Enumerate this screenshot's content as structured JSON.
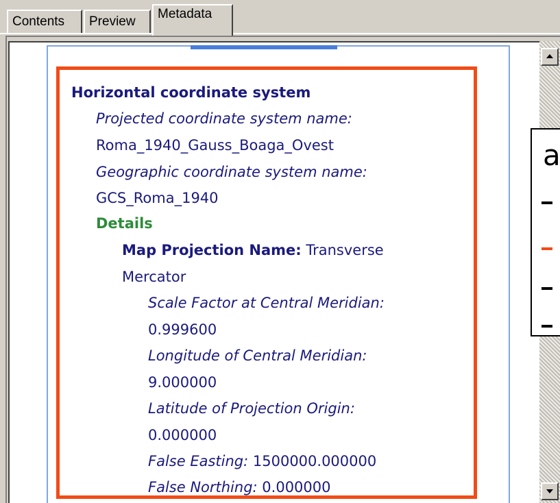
{
  "tabs": [
    {
      "label": "Contents",
      "active": false
    },
    {
      "label": "Preview",
      "active": false
    },
    {
      "label": "Metadata",
      "active": true
    }
  ],
  "metadata": {
    "heading": "Horizontal coordinate system",
    "projected_label": "Projected coordinate system name:",
    "projected_value": "Roma_1940_Gauss_Boaga_Ovest",
    "geographic_label": "Geographic coordinate system name:",
    "geographic_value": "GCS_Roma_1940",
    "details_heading": "Details",
    "map_projection_label": "Map Projection Name:",
    "map_projection_value_1": "Transverse",
    "map_projection_value_2": "Mercator",
    "scale_factor_label": "Scale Factor at Central Meridian:",
    "scale_factor_value": "0.999600",
    "longitude_label": "Longitude of Central Meridian:",
    "longitude_value": "9.000000",
    "latitude_label": "Latitude of Projection Origin:",
    "latitude_value": "0.000000",
    "false_easting_label": "False Easting:",
    "false_easting_value": "1500000.000000",
    "false_northing_label": "False Northing:",
    "false_northing_value": "0.000000"
  },
  "overlay": {
    "letter": "a"
  },
  "colors": {
    "highlight": "#f24b17",
    "heading": "#1a1a7e",
    "details": "#2e8b3a",
    "page_outline": "#7fa7e0"
  },
  "icons": {
    "scroll_up": "triangle-up",
    "scroll_down": "triangle-down"
  }
}
